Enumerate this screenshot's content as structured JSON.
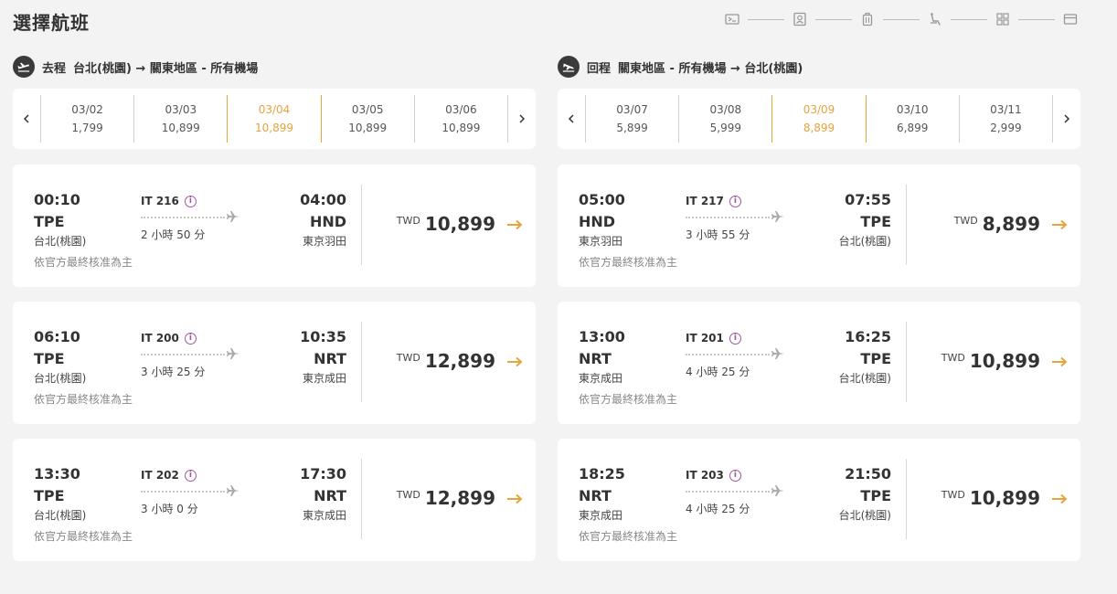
{
  "page": {
    "title": "選擇航班"
  },
  "steps": [
    {
      "icon": "boarding-pass-icon"
    },
    {
      "icon": "passenger-icon"
    },
    {
      "icon": "baggage-icon"
    },
    {
      "icon": "seat-icon"
    },
    {
      "icon": "grid-icon"
    },
    {
      "icon": "payment-card-icon"
    }
  ],
  "outbound": {
    "label": "去程",
    "route": "台北(桃園) → 關東地區 - 所有機場",
    "dates": [
      {
        "date": "03/02",
        "price": "1,799",
        "selected": false
      },
      {
        "date": "03/03",
        "price": "10,899",
        "selected": false
      },
      {
        "date": "03/04",
        "price": "10,899",
        "selected": true
      },
      {
        "date": "03/05",
        "price": "10,899",
        "selected": false
      },
      {
        "date": "03/06",
        "price": "10,899",
        "selected": false
      }
    ],
    "flights": [
      {
        "dep_time": "00:10",
        "dep_code": "TPE",
        "dep_city": "台北(桃園)",
        "flight_no": "IT 216",
        "duration": "2 小時 50 分",
        "arr_time": "04:00",
        "arr_code": "HND",
        "arr_city": "東京羽田",
        "note": "依官方最終核准為主",
        "currency": "TWD",
        "price": "10,899"
      },
      {
        "dep_time": "06:10",
        "dep_code": "TPE",
        "dep_city": "台北(桃園)",
        "flight_no": "IT 200",
        "duration": "3 小時 25 分",
        "arr_time": "10:35",
        "arr_code": "NRT",
        "arr_city": "東京成田",
        "note": "依官方最終核准為主",
        "currency": "TWD",
        "price": "12,899"
      },
      {
        "dep_time": "13:30",
        "dep_code": "TPE",
        "dep_city": "台北(桃園)",
        "flight_no": "IT 202",
        "duration": "3 小時 0 分",
        "arr_time": "17:30",
        "arr_code": "NRT",
        "arr_city": "東京成田",
        "note": "依官方最終核准為主",
        "currency": "TWD",
        "price": "12,899"
      }
    ]
  },
  "return": {
    "label": "回程",
    "route": "關東地區 - 所有機場 → 台北(桃園)",
    "dates": [
      {
        "date": "03/07",
        "price": "5,899",
        "selected": false
      },
      {
        "date": "03/08",
        "price": "5,999",
        "selected": false
      },
      {
        "date": "03/09",
        "price": "8,899",
        "selected": true
      },
      {
        "date": "03/10",
        "price": "6,899",
        "selected": false
      },
      {
        "date": "03/11",
        "price": "2,999",
        "selected": false
      }
    ],
    "flights": [
      {
        "dep_time": "05:00",
        "dep_code": "HND",
        "dep_city": "東京羽田",
        "flight_no": "IT 217",
        "duration": "3 小時 55 分",
        "arr_time": "07:55",
        "arr_code": "TPE",
        "arr_city": "台北(桃園)",
        "note": "依官方最終核准為主",
        "currency": "TWD",
        "price": "8,899"
      },
      {
        "dep_time": "13:00",
        "dep_code": "NRT",
        "dep_city": "東京成田",
        "flight_no": "IT 201",
        "duration": "4 小時 25 分",
        "arr_time": "16:25",
        "arr_code": "TPE",
        "arr_city": "台北(桃園)",
        "note": "依官方最終核准為主",
        "currency": "TWD",
        "price": "10,899"
      },
      {
        "dep_time": "18:25",
        "dep_code": "NRT",
        "dep_city": "東京成田",
        "flight_no": "IT 203",
        "duration": "4 小時 25 分",
        "arr_time": "21:50",
        "arr_code": "TPE",
        "arr_city": "台北(桃園)",
        "note": "依官方最終核准為主",
        "currency": "TWD",
        "price": "10,899"
      }
    ]
  },
  "colors": {
    "accent": "#e8a33d",
    "info": "#a0589c",
    "text": "#333333",
    "background": "#f3f3f3"
  }
}
